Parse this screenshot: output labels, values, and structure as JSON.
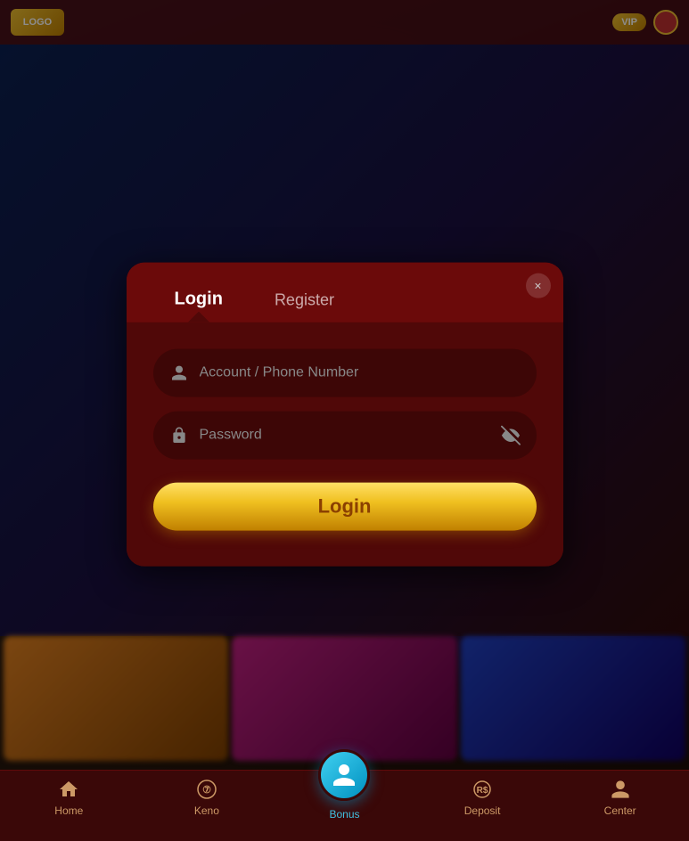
{
  "header": {
    "logo_text": "LOGO",
    "badge_text": "VIP",
    "close_label": "×"
  },
  "modal": {
    "tab_login": "Login",
    "tab_register": "Register",
    "account_placeholder": "Account / Phone Number",
    "password_placeholder": "Password",
    "login_button": "Login"
  },
  "bottom_nav": {
    "items": [
      {
        "id": "home",
        "label": "Home",
        "icon": "🏠"
      },
      {
        "id": "keno",
        "label": "Keno",
        "icon": "⑦"
      },
      {
        "id": "bonus",
        "label": "Bonus",
        "icon": "👤"
      },
      {
        "id": "deposit",
        "label": "Deposit",
        "icon": "💰"
      },
      {
        "id": "center",
        "label": "Center",
        "icon": "👤"
      }
    ]
  },
  "icons": {
    "user": "👤",
    "lock": "🔒",
    "eye_slash": "👁",
    "close": "×"
  }
}
